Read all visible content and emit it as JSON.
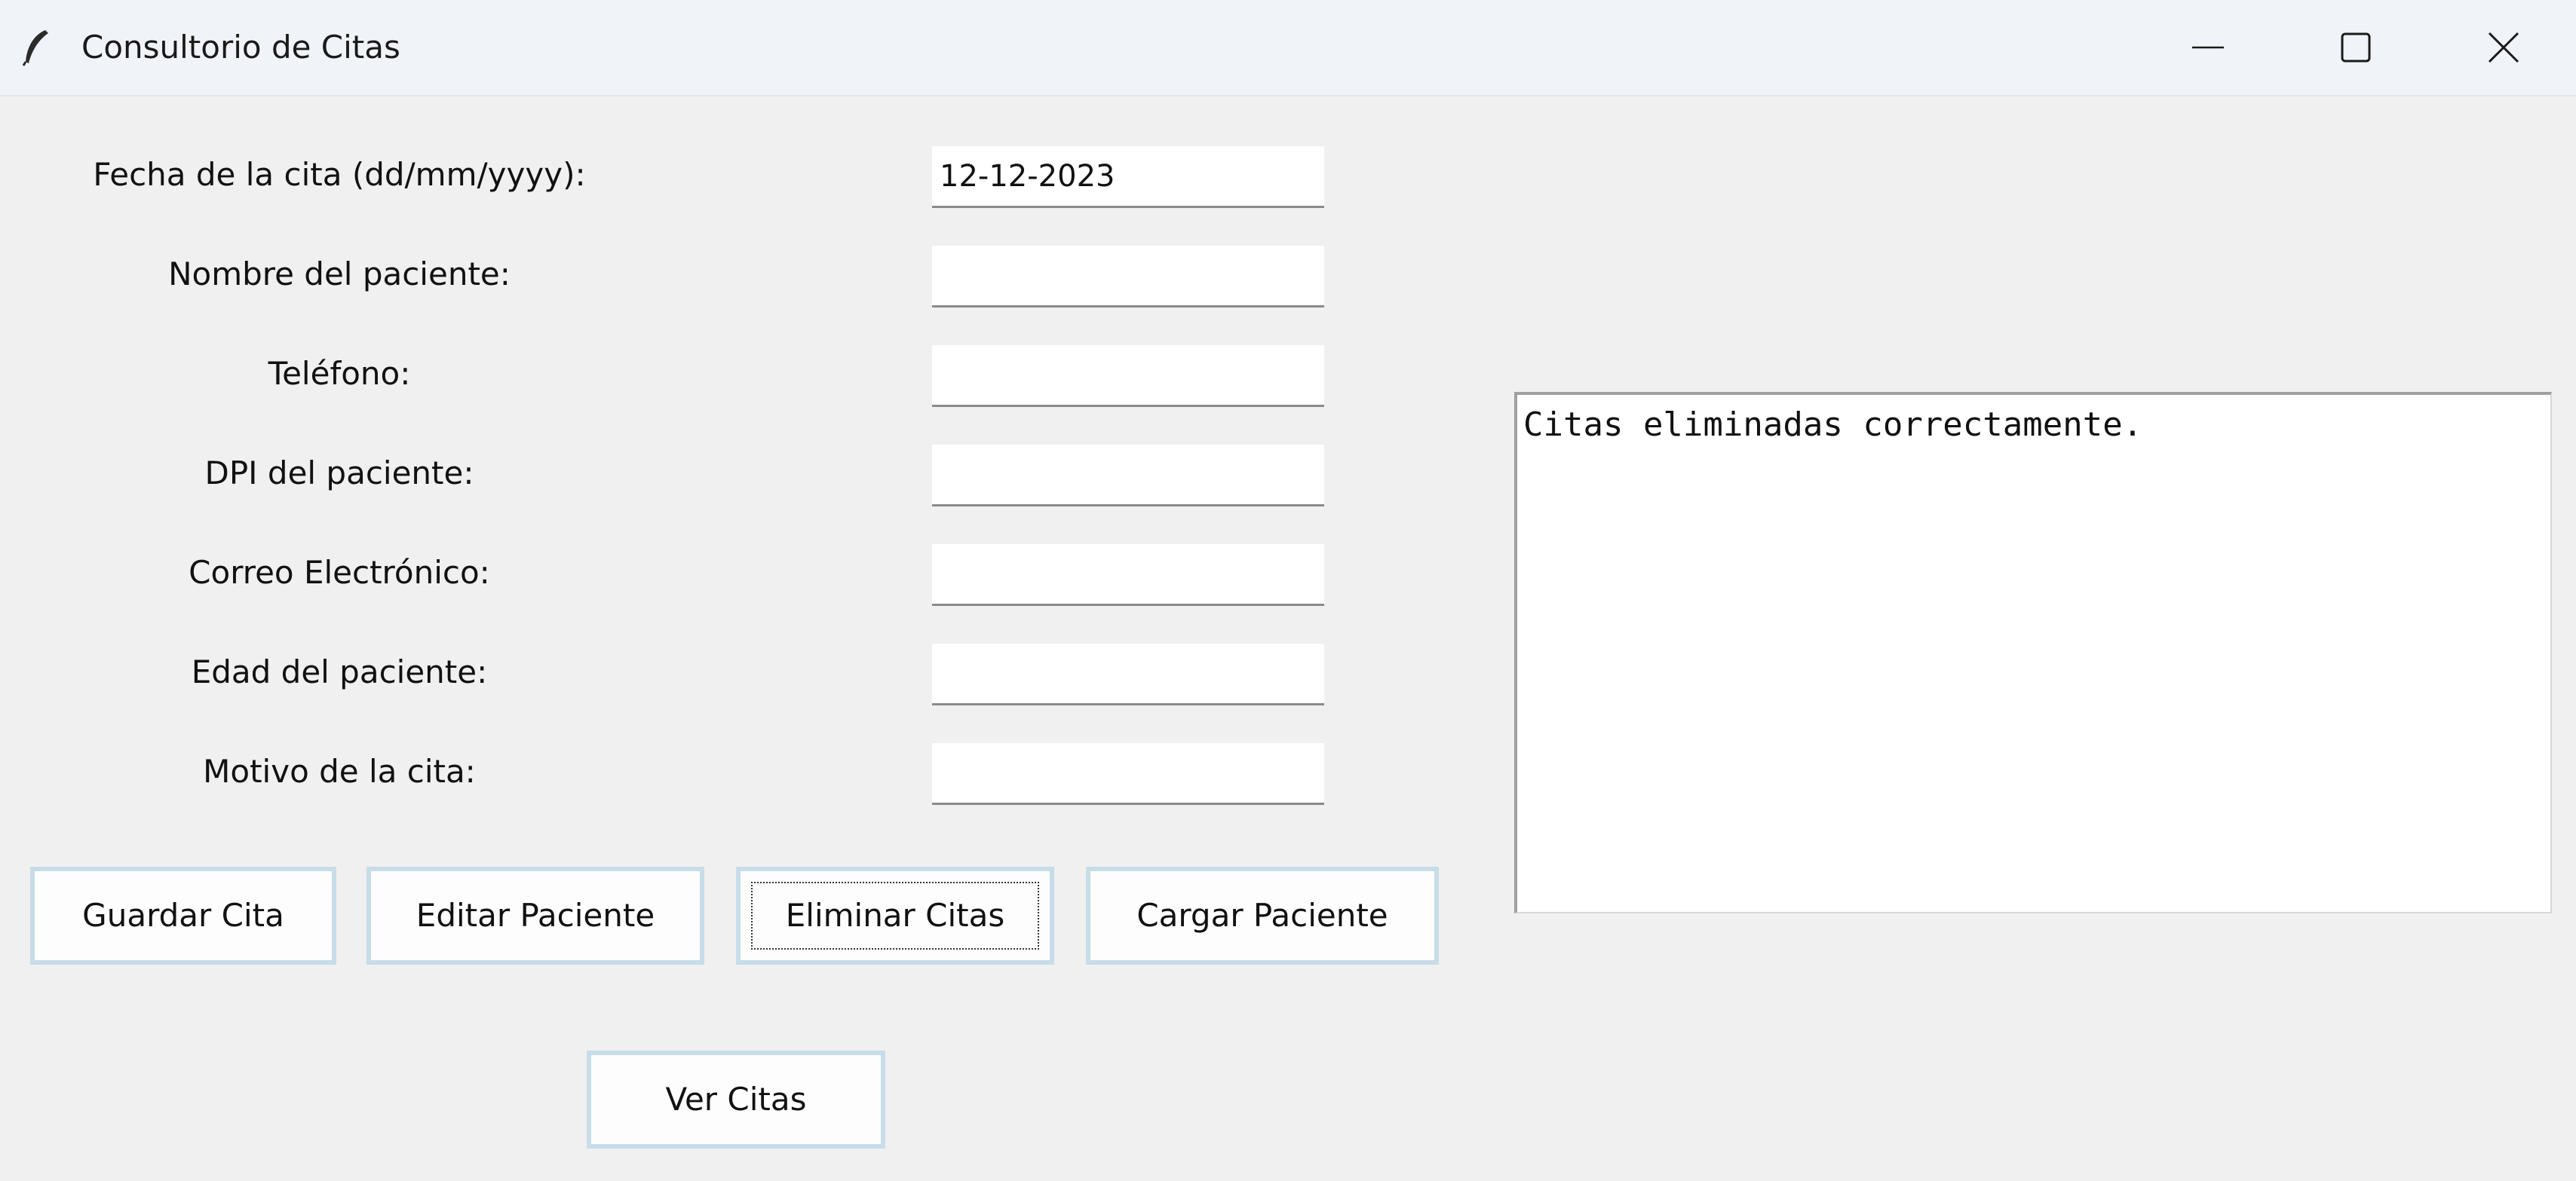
{
  "window": {
    "title": "Consultorio de Citas",
    "icon": "feather-icon",
    "controls": {
      "minimize": "minimize-icon",
      "maximize": "maximize-icon",
      "close": "close-icon"
    }
  },
  "form": {
    "fields": [
      {
        "label": "Fecha de la cita (dd/mm/yyyy):",
        "value": "12-12-2023",
        "placeholder": ""
      },
      {
        "label": "Nombre del paciente:",
        "value": "",
        "placeholder": ""
      },
      {
        "label": "Teléfono:",
        "value": "",
        "placeholder": ""
      },
      {
        "label": "DPI del paciente:",
        "value": "",
        "placeholder": ""
      },
      {
        "label": "Correo Electrónico:",
        "value": "",
        "placeholder": ""
      },
      {
        "label": "Edad del paciente:",
        "value": "",
        "placeholder": ""
      },
      {
        "label": "Motivo de la cita:",
        "value": "",
        "placeholder": ""
      }
    ]
  },
  "buttons": {
    "guardar": "Guardar Cita",
    "editar": "Editar Paciente",
    "eliminar": "Eliminar Citas",
    "cargar": "Cargar Paciente",
    "ver": "Ver Citas"
  },
  "output": {
    "text": "Citas eliminadas correctamente."
  },
  "colors": {
    "background": "#f0f0f0",
    "titlebar": "#f0f4f9",
    "button_border": "#c7dde8"
  }
}
